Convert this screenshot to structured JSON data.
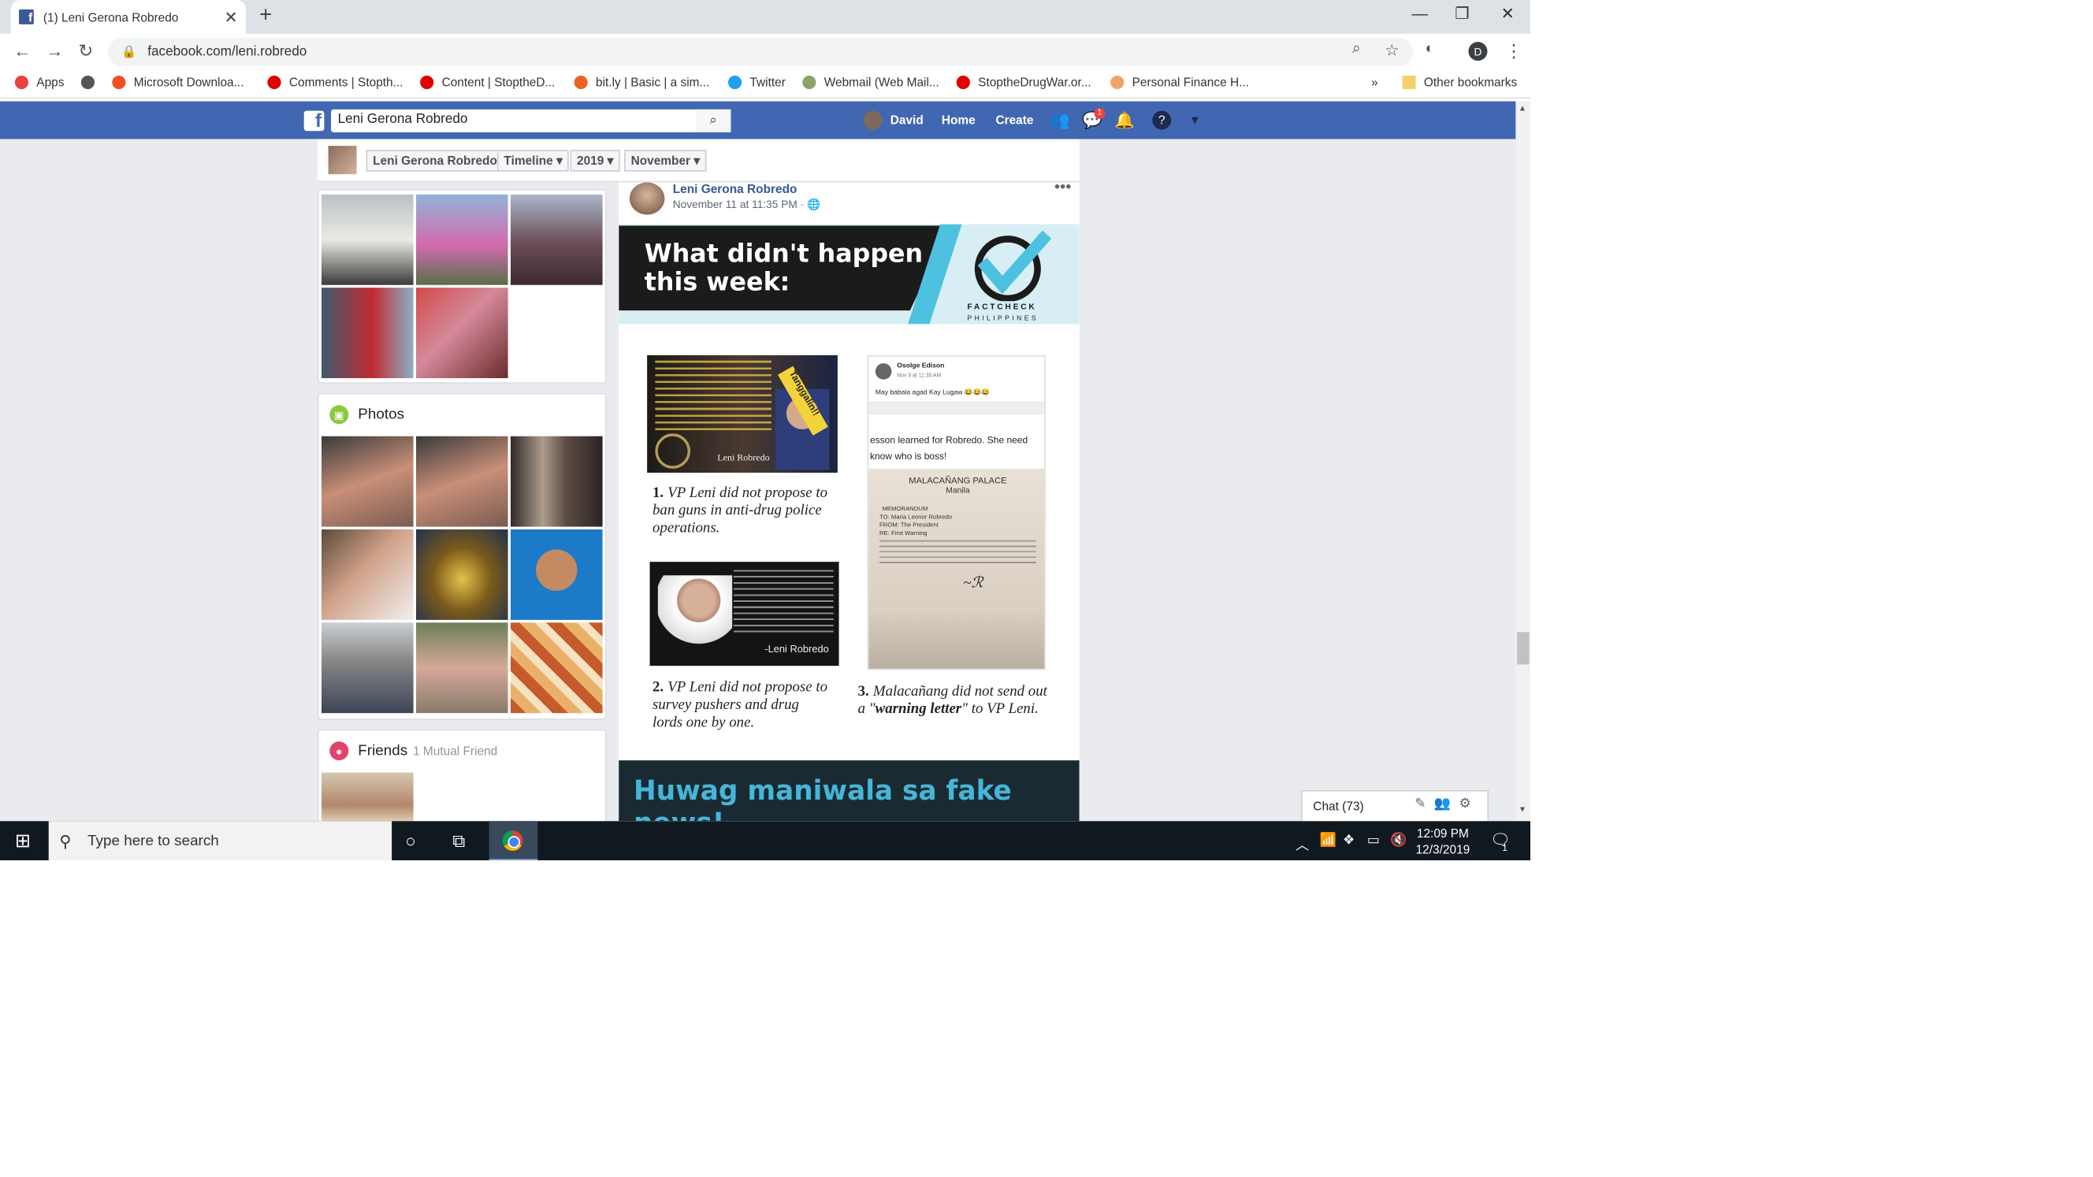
{
  "browser": {
    "tab_title": "(1) Leni Gerona Robredo",
    "url": "facebook.com/leni.robredo",
    "profile_initial": "D",
    "bookmarks": [
      {
        "label": "Apps",
        "color": "#e8453c"
      },
      {
        "label": "",
        "color": "#555555"
      },
      {
        "label": "Microsoft Downloa...",
        "color": "#f25022"
      },
      {
        "label": "Comments | Stopth...",
        "color": "#e00000"
      },
      {
        "label": "Content | StoptheD...",
        "color": "#e00000"
      },
      {
        "label": "bit.ly | Basic | a sim...",
        "color": "#ee6123"
      },
      {
        "label": "Twitter",
        "color": "#1da1f2"
      },
      {
        "label": "Webmail (Web Mail...",
        "color": "#8aa36a"
      },
      {
        "label": "StoptheDrugWar.or...",
        "color": "#e00000"
      },
      {
        "label": "Personal Finance H...",
        "color": "#f0a46a"
      }
    ],
    "other_bookmarks": "Other bookmarks",
    "more_chevron": "»"
  },
  "facebook": {
    "search_value": "Leni Gerona Robredo",
    "user_name": "David",
    "nav_home": "Home",
    "nav_create": "Create",
    "messages_badge": "1",
    "brand_color": "#4267b2"
  },
  "timeline_nav": {
    "name": "Leni Gerona Robredo",
    "timeline": "Timeline",
    "year": "2019",
    "month": "November"
  },
  "sidebar": {
    "photos_title": "Photos",
    "friends_title": "Friends",
    "friends_sub": "1 Mutual Friend"
  },
  "post": {
    "author": "Leni Gerona Robredo",
    "timestamp": "November 11 at 11:35 PM",
    "banner_title_line1": "What didn't happen",
    "banner_title_line2": "this week:",
    "factcheck_line1": "FACTCHECK",
    "factcheck_line2": "PHILIPPINES",
    "claim1_num": "1.",
    "claim1_text": "VP Leni did not propose to ban guns in anti-drug police operations.",
    "claim2_num": "2.",
    "claim2_text": "VP Leni did not propose to survey pushers and drug lords one by one.",
    "claim3_num": "3.",
    "claim3_pre": "Malacañang did not send out a \"",
    "claim3_bold": "warning letter",
    "claim3_post": "\" to VP Leni.",
    "thumb1_stamp": "Tanggalin!!",
    "thumb1_caption": "Leni Robredo",
    "thumb2_caption": "-Leni Robredo",
    "thumb3_user": "Osolge Edison",
    "thumb3_time": "Nov 9 at 11:35 AM",
    "thumb3_post": "May babala agad Kay Lugaw 😂😂😂",
    "thumb3_lesson": "esson learned for Robredo.  She need know who is boss!",
    "thumb3_palace": "MALACAÑANG PALACE",
    "thumb3_city": "Manila",
    "thumb3_memo": "MEMORANDUM",
    "thumb3_to": "TO: Maria Leonor Robredo",
    "thumb3_from": "FROM: The President",
    "thumb3_re": "RE: First Warning",
    "footer": "Huwag maniwala sa fake news!"
  },
  "chat": {
    "label": "Chat (73)"
  },
  "taskbar": {
    "search_placeholder": "Type here to search",
    "time": "12:09 PM",
    "date": "12/3/2019",
    "notif_count": "1"
  }
}
